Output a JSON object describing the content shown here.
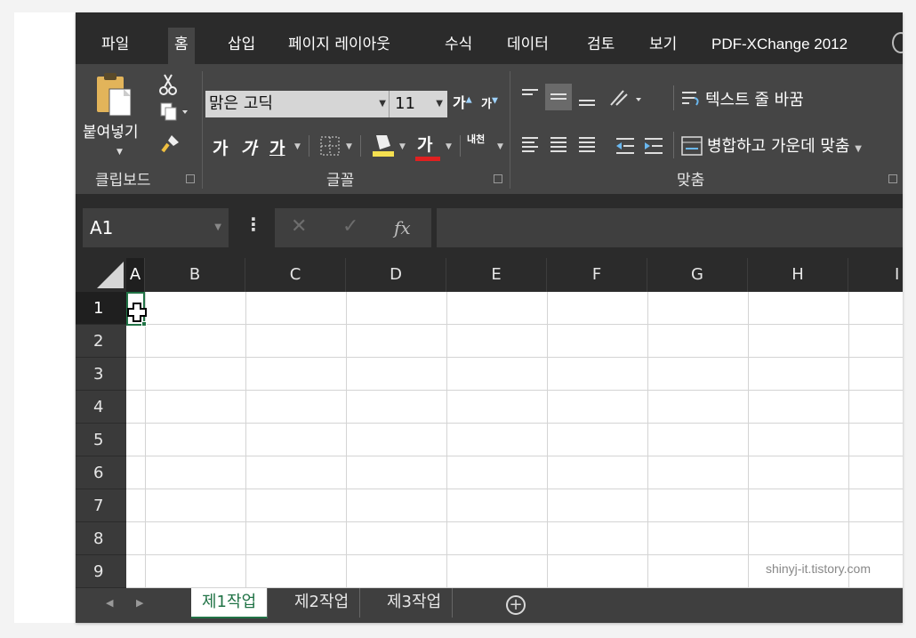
{
  "tabs": [
    "파일",
    "홈",
    "삽입",
    "페이지 레이아웃",
    "수식",
    "데이터",
    "검토",
    "보기",
    "PDF-XChange 2012"
  ],
  "active_tab": "홈",
  "clipboard": {
    "paste_label": "붙여넣기",
    "group_label": "클립보드"
  },
  "font": {
    "name": "맑은 고딕",
    "size": "11",
    "grow": "가",
    "shrink": "가",
    "bold": "가",
    "italic": "가",
    "underline": "가",
    "font_color": "가",
    "phonetic": "내천",
    "group_label": "글꼴"
  },
  "alignment": {
    "wrap_text": "텍스트 줄 바꿈",
    "merge_center": "병합하고 가운데 맞춤",
    "group_label": "맞춤"
  },
  "formula_bar": {
    "name_box": "A1",
    "fx": "fx",
    "cancel": "✕",
    "enter": "✓",
    "dots": "⋮"
  },
  "columns": [
    "A",
    "B",
    "C",
    "D",
    "E",
    "F",
    "G",
    "H",
    "I"
  ],
  "rows": [
    "1",
    "2",
    "3",
    "4",
    "5",
    "6",
    "7",
    "8",
    "9"
  ],
  "selected_cell": "A1",
  "sheets": [
    "제1작업",
    "제2작업",
    "제3작업"
  ],
  "active_sheet": "제1작업",
  "add_sheet": "+",
  "nav": {
    "prev": "◀",
    "next": "▶"
  },
  "watermark": "shinyj-it.tistory.com",
  "colors": {
    "chrome_dark": "#2b2b2b",
    "ribbon": "#454545",
    "excel_green": "#217346",
    "grid_line": "#d4d4d4"
  }
}
